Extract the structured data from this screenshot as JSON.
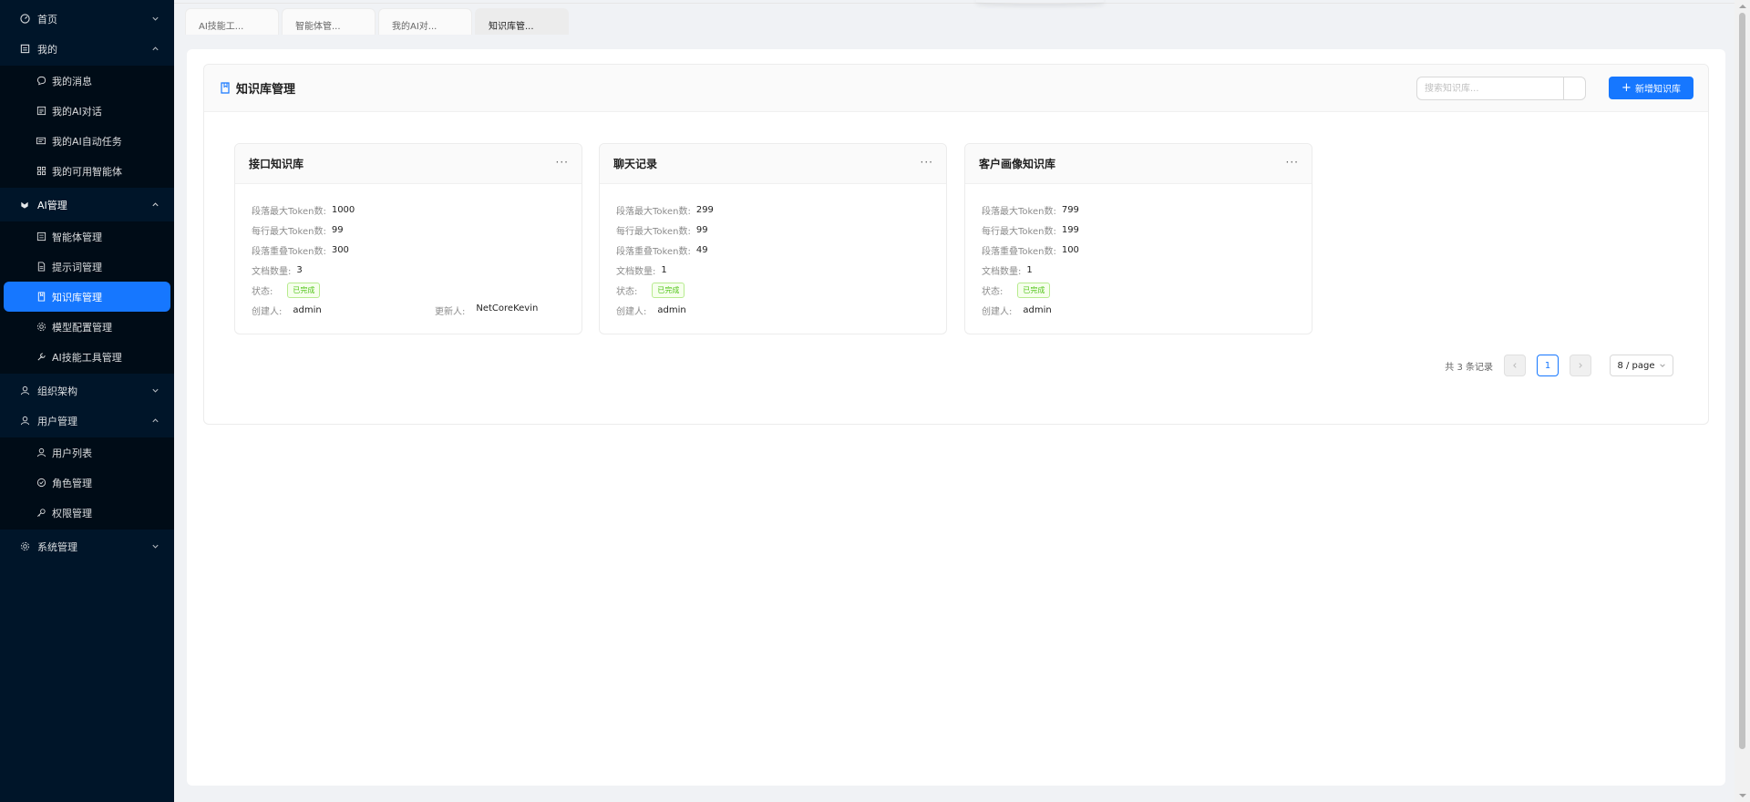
{
  "sidebar": {
    "home": "首页",
    "mine": "我的",
    "mine_items": [
      "我的消息",
      "我的AI对话",
      "我的AI自动任务",
      "我的可用智能体"
    ],
    "ai": "AI管理",
    "ai_items": [
      "智能体管理",
      "提示词管理",
      "知识库管理",
      "模型配置管理",
      "AI技能工具管理"
    ],
    "org": "组织架构",
    "users": "用户管理",
    "user_items": [
      "用户列表",
      "角色管理",
      "权限管理"
    ],
    "system": "系统管理"
  },
  "tabs": [
    "AI技能工...",
    "智能体管...",
    "我的AI对...",
    "知识库管..."
  ],
  "panel": {
    "title": "知识库管理",
    "search_placeholder": "搜索知识库...",
    "add_label": "新增知识库"
  },
  "labels": {
    "max_paragraph_token": "段落最大Token数:",
    "max_line_token": "每行最大Token数:",
    "overlap_token": "段落重叠Token数:",
    "doc_count": "文档数量:",
    "status": "状态:",
    "creator": "创建人:",
    "updater": "更新人:"
  },
  "cards": [
    {
      "title": "接口知识库",
      "max_paragraph_token": "1000",
      "max_line_token": "99",
      "overlap_token": "300",
      "doc_count": "3",
      "status": "已完成",
      "creator": "admin",
      "updater": "NetCoreKevin"
    },
    {
      "title": "聊天记录",
      "max_paragraph_token": "299",
      "max_line_token": "99",
      "overlap_token": "49",
      "doc_count": "1",
      "status": "已完成",
      "creator": "admin"
    },
    {
      "title": "客户画像知识库",
      "max_paragraph_token": "799",
      "max_line_token": "199",
      "overlap_token": "100",
      "doc_count": "1",
      "status": "已完成",
      "creator": "admin"
    }
  ],
  "pagination": {
    "total": "共 3 条记录",
    "current": "1",
    "page_size": "8 / page"
  },
  "colors": {
    "primary": "#1677ff",
    "sidebar_bg": "#001529",
    "success": "#52c41a"
  }
}
